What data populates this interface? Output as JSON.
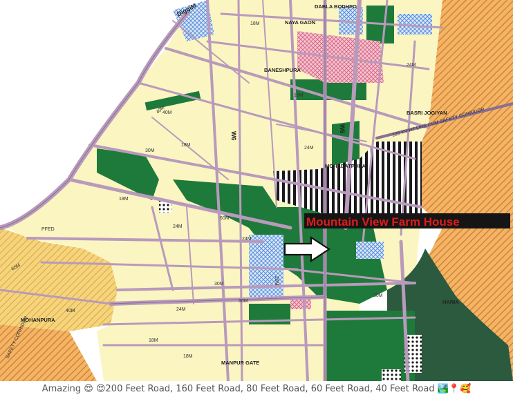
{
  "map": {
    "highlight_label": "Mountain View Farm House",
    "place_names": [
      "DABLA BODHPO",
      "NAYA GAON",
      "BANESHPURA",
      "BASRI JOGIYAN",
      "MOHABATPURA",
      "MOHANPURA",
      "MANPUR GATE",
      "HARIA",
      "DiggiM"
    ],
    "corridor_labels": [
      "220 KV HT LINE CUM SAFETY CORRIDOR",
      "SAFETY CORRIDOR"
    ],
    "road_labels": [
      "18M",
      "24M",
      "30M",
      "40M",
      "60M",
      "18M",
      "24M",
      "30M",
      "18M",
      "24M",
      "18M",
      "24M",
      "30M",
      "18M",
      "24M",
      "40M",
      "18M",
      "30M"
    ],
    "road_ids": [
      "W6",
      "W6",
      "60M",
      "20M",
      "40M",
      "PFED"
    ],
    "colors": {
      "residential": "#fbf5c2",
      "green": "#1e7a3a",
      "dark_green": "#2b5a3e",
      "roads": "#b89abb",
      "orange": "#e49a46",
      "blue_hatch": "#5b8fd6",
      "pink": "#e9a7b8",
      "label_bg": "#151515",
      "label_text": "#e21b1b"
    }
  },
  "caption": {
    "text": "Amazing 😍 😍200 Feet Road, 160 Feet Road, 80 Feet Road, 60 Feet Road, 40 Feet Road 🏞️📍🥰"
  }
}
